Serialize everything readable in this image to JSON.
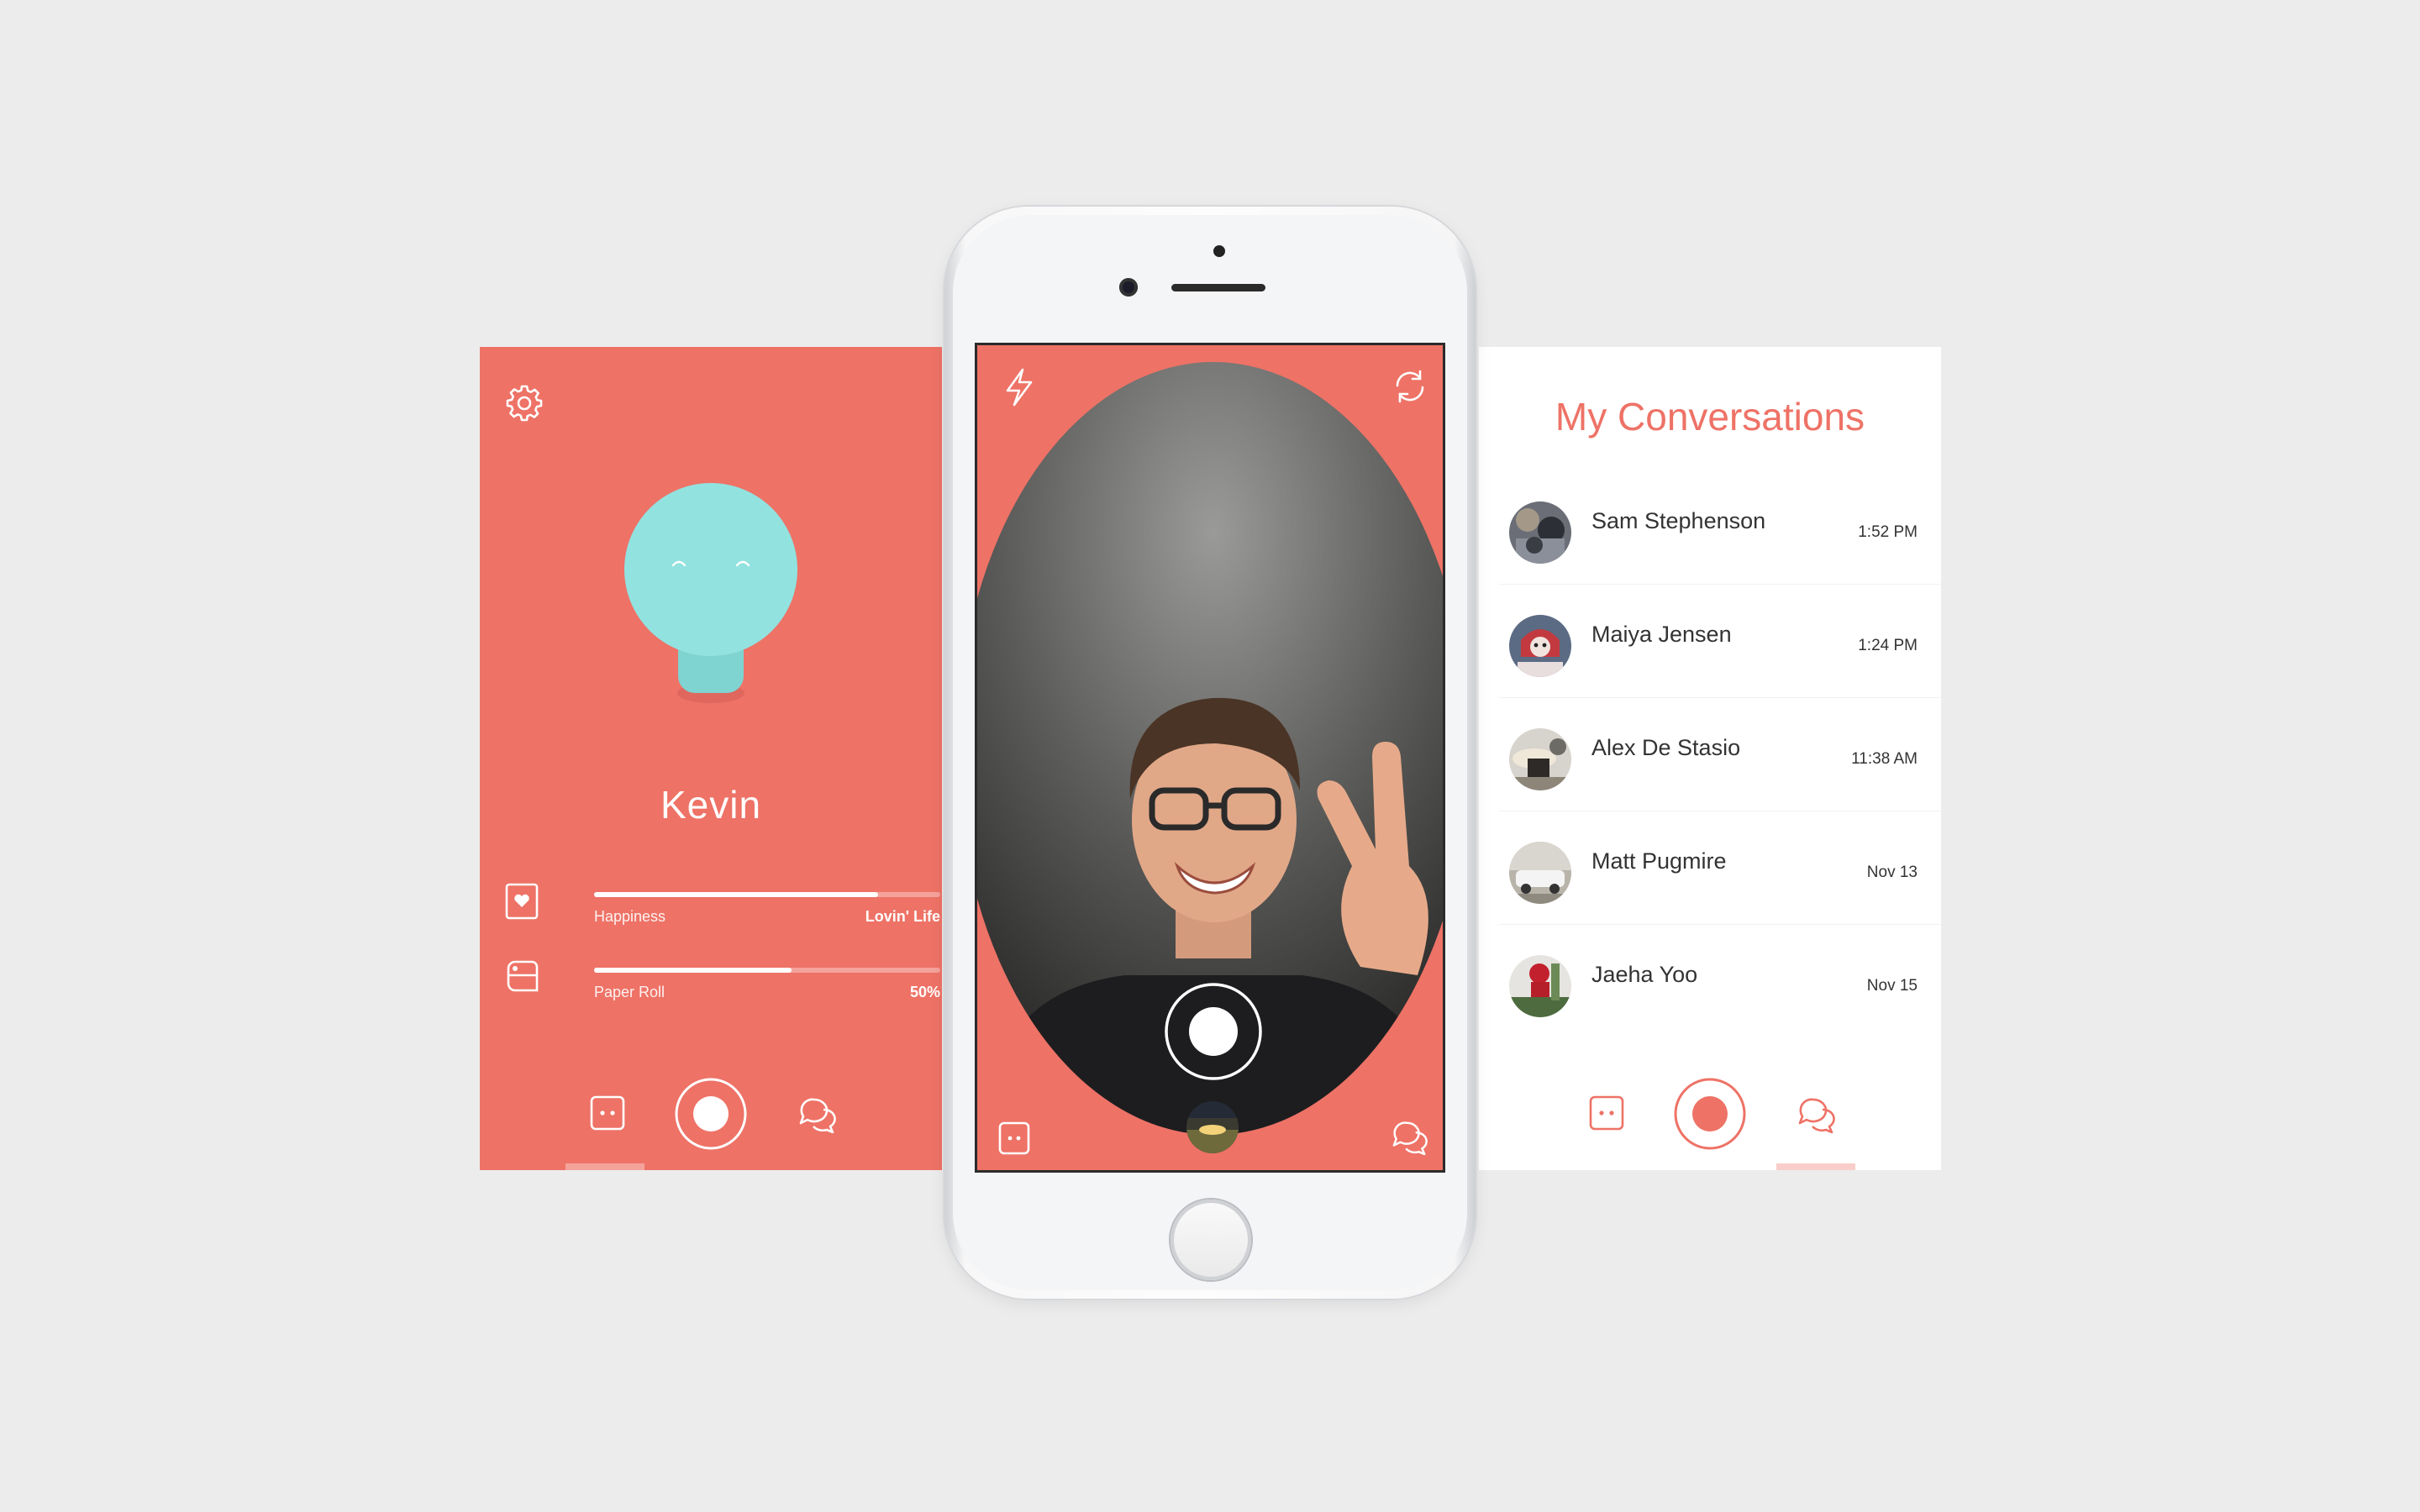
{
  "colors": {
    "accent": "#ee7266",
    "background": "#ececec",
    "pet_body": "#8fe0df",
    "white": "#ffffff"
  },
  "pet_screen": {
    "settings_icon": "gear-icon",
    "pet_name": "Kevin",
    "stats": [
      {
        "icon": "heart-icon",
        "label": "Happiness",
        "value": "Lovin' Life",
        "level": 0.82
      },
      {
        "icon": "paper-roll-icon",
        "label": "Paper Roll",
        "value": "50%",
        "level": 0.57
      }
    ],
    "tabs": [
      "pet-face-icon",
      "camera-shutter-icon",
      "chat-bubbles-icon"
    ],
    "active_tab": "pet"
  },
  "camera_screen": {
    "top_left_icon": "flash-icon",
    "top_right_icon": "flip-camera-icon",
    "bottom_left_icon": "pet-face-icon",
    "bottom_right_icon": "chat-bubbles-icon",
    "capture_icon": "shutter-button-icon"
  },
  "conversations_screen": {
    "title": "My Conversations",
    "conversations": [
      {
        "name": "Sam Stephenson",
        "time": "1:52 PM"
      },
      {
        "name": "Maiya Jensen",
        "time": "1:24 PM"
      },
      {
        "name": "Alex De Stasio",
        "time": "11:38 AM"
      },
      {
        "name": "Matt Pugmire",
        "time": "Nov 13"
      },
      {
        "name": "Jaeha Yoo",
        "time": "Nov 15"
      }
    ],
    "tabs": [
      "pet-face-icon",
      "camera-shutter-icon",
      "chat-bubbles-icon"
    ],
    "active_tab": "chat"
  }
}
